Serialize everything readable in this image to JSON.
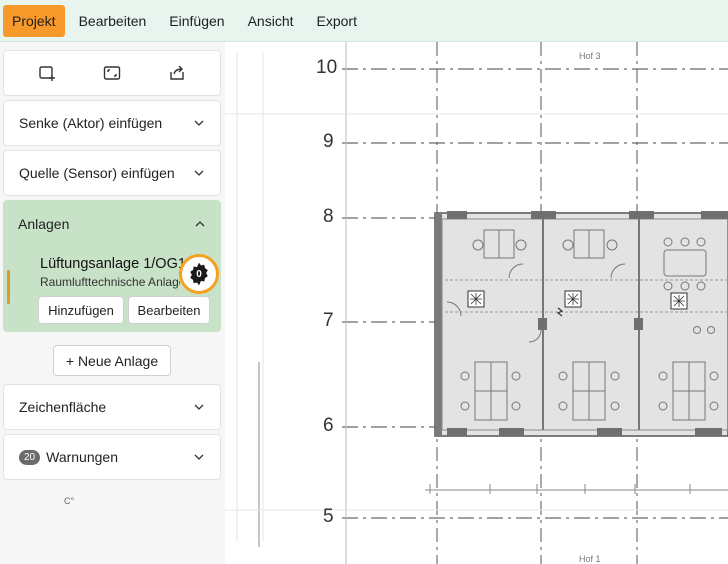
{
  "menu": {
    "items": [
      "Projekt",
      "Bearbeiten",
      "Einfügen",
      "Ansicht",
      "Export"
    ],
    "active": "Projekt"
  },
  "sidebar": {
    "tools": [
      {
        "icon": "add-frame-icon"
      },
      {
        "icon": "fit-view-icon"
      },
      {
        "icon": "share-icon"
      }
    ],
    "senke_label": "Senke (Aktor) einfügen",
    "quelle_label": "Quelle (Sensor) einfügen",
    "anlagen": {
      "label": "Anlagen",
      "expanded": true,
      "item": {
        "title": "Lüftungsanlage 1/OG1",
        "subtitle": "Raumlufttechnische Anlage",
        "gear_count": "0",
        "add_label": "Hinzufügen",
        "edit_label": "Bearbeiten"
      },
      "new_label": "+ Neue Anlage"
    },
    "zeichenflaeche_label": "Zeichenfläche",
    "warnungen": {
      "count": "20",
      "label": "Warnungen"
    }
  },
  "canvas": {
    "axis_labels": [
      "10",
      "9",
      "8",
      "7",
      "6",
      "5"
    ],
    "hof_top": "Hof 3",
    "hof_bottom": "Hof 1",
    "small_label": "C",
    "small_label_2": "°"
  },
  "colors": {
    "menubar_bg": "#e8f5ef",
    "active_menu": "#f79a2b",
    "anlagen_bg": "#c8e2c8",
    "highlight_ring": "#f5a020",
    "accent_bar": "#d99a3a"
  }
}
